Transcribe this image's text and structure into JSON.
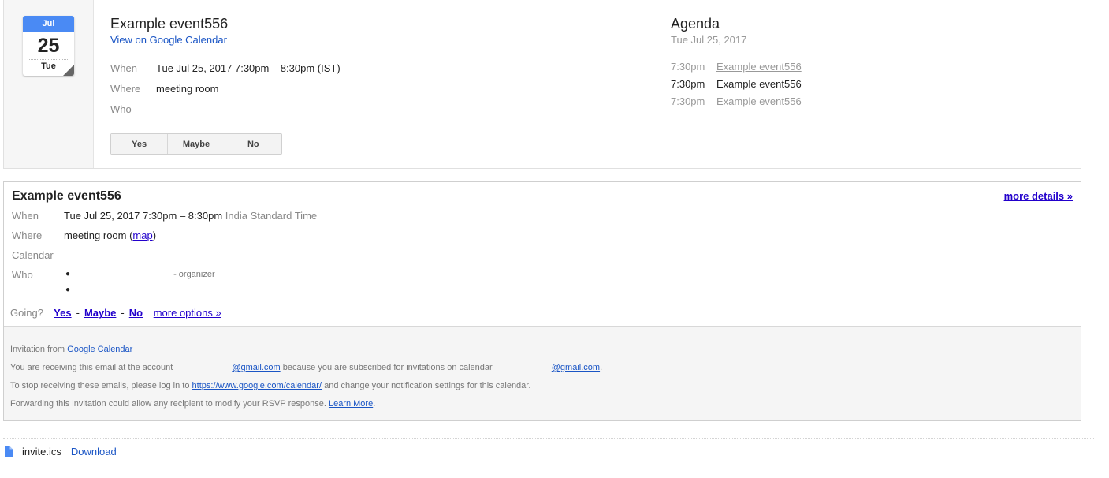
{
  "event": {
    "month": "Jul",
    "day": "25",
    "weekday": "Tue",
    "title": "Example event556",
    "gcal_link": "View on Google Calendar",
    "when_label": "When",
    "when_value": "Tue Jul 25, 2017 7:30pm – 8:30pm (IST)",
    "where_label": "Where",
    "where_value": "meeting room",
    "who_label": "Who",
    "rsvp": {
      "yes": "Yes",
      "maybe": "Maybe",
      "no": "No"
    }
  },
  "agenda": {
    "title": "Agenda",
    "date": "Tue Jul 25, 2017",
    "items": [
      {
        "time": "7:30pm",
        "name": "Example event556"
      },
      {
        "time": "7:30pm",
        "name": "Example event556"
      },
      {
        "time": "7:30pm",
        "name": "Example event556"
      }
    ]
  },
  "details": {
    "title": "Example event556",
    "more_details": "more details »",
    "when_label": "When",
    "when_value": "Tue Jul 25, 2017 7:30pm – 8:30pm",
    "when_tz": "India Standard Time",
    "where_label": "Where",
    "where_value": "meeting room (",
    "map_link": "map",
    "where_close": ")",
    "calendar_label": "Calendar",
    "who_label": "Who",
    "organizer_role": "- organizer",
    "going_label": "Going?",
    "going_yes": "Yes",
    "going_maybe": "Maybe",
    "going_no": "No",
    "going_sep": "-",
    "more_options": "more options »"
  },
  "footer": {
    "invitation_from": "Invitation from",
    "google_calendar_link": "Google Calendar",
    "receiving_prefix": "You are receiving this email at the account",
    "gmail_suffix": "@gmail.com",
    "receiving_middle": "because you are subscribed for invitations on calendar",
    "gmail_suffix_2": "@gmail.com",
    "stop_prefix": "To stop receiving these emails, please log in to",
    "calendar_url": "https://www.google.com/calendar/",
    "stop_suffix": "and change your notification settings for this calendar.",
    "forwarding_text": "Forwarding this invitation could allow any recipient to modify your RSVP response.",
    "learn_more": "Learn More",
    "period": "."
  },
  "attachment": {
    "filename": "invite.ics",
    "download": "Download",
    "icon": "file-icon",
    "icon_color": "#4a8af4"
  },
  "colors": {
    "accent_blue": "#4a8af4",
    "link_blue": "#1a55c5",
    "legacy_link": "#2200cc",
    "muted_text": "#888888"
  }
}
